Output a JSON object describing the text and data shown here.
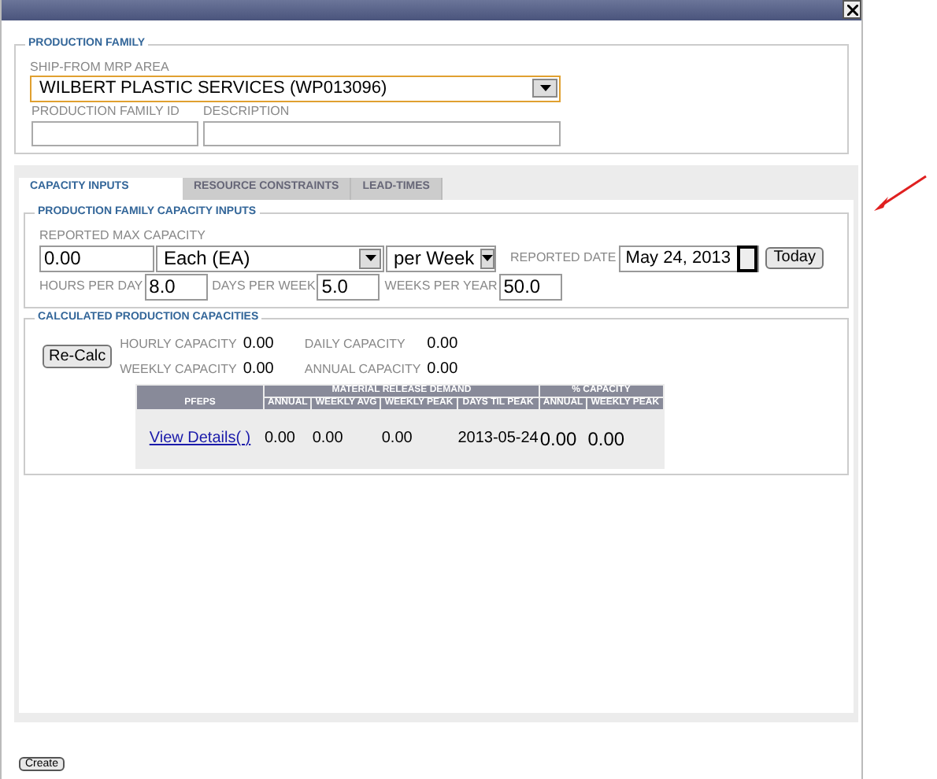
{
  "production_family": {
    "legend": "PRODUCTION FAMILY",
    "ship_from": {
      "label": "SHIP-FROM MRP AREA",
      "value": "WILBERT PLASTIC SERVICES (WP013096)"
    },
    "fields": [
      {
        "label": "PRODUCTION FAMILY ID"
      },
      {
        "label": "DESCRIPTION"
      }
    ]
  },
  "tabs": [
    {
      "label": "CAPACITY INPUTS",
      "selected": true
    },
    {
      "label": "RESOURCE CONSTRAINTS",
      "selected": false
    },
    {
      "label": "LEAD-TIMES",
      "selected": false
    }
  ],
  "capacity_inputs": {
    "legend": "PRODUCTION FAMILY CAPACITY INPUTS",
    "max_capacity": {
      "label": "REPORTED MAX CAPACITY",
      "value": "0.00",
      "unit": "Each (EA)",
      "period": "per Week"
    },
    "reported_date": {
      "label": "REPORTED DATE",
      "value": "May 24, 2013",
      "today_button": "Today"
    },
    "rates": [
      {
        "label": "HOURS PER DAY",
        "value": "8.0"
      },
      {
        "label": "DAYS PER WEEK",
        "value": "5.0"
      },
      {
        "label": "WEEKS PER YEAR",
        "value": "50.0"
      }
    ]
  },
  "calculated": {
    "legend": "CALCULATED PRODUCTION CAPACITIES",
    "recalc_button": "Re-Calc",
    "metrics": [
      {
        "label": "HOURLY CAPACITY",
        "value": "0.00"
      },
      {
        "label": "DAILY CAPACITY",
        "value": "0.00"
      },
      {
        "label": "WEEKLY CAPACITY",
        "value": "0.00"
      },
      {
        "label": "ANNUAL CAPACITY",
        "value": "0.00"
      }
    ],
    "table": {
      "first_column": "PFEPS",
      "groups": [
        {
          "label": "MATERIAL RELEASE DEMAND",
          "columns": [
            "ANNUAL",
            "WEEKLY AVG",
            "WEEKLY PEAK",
            "DAYS TIL PEAK"
          ]
        },
        {
          "label": "% CAPACITY",
          "columns": [
            "ANNUAL",
            "WEEKLY PEAK"
          ]
        }
      ],
      "rows": [
        {
          "link": "View Details( )",
          "cells": [
            "0.00",
            "0.00",
            "0.00",
            "2013-05-24",
            "0.00",
            "0.00"
          ]
        }
      ]
    }
  },
  "create_button": "Create"
}
